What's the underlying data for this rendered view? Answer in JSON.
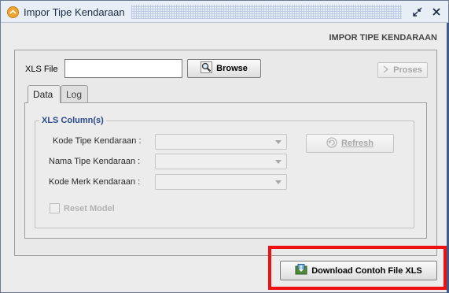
{
  "window": {
    "title": "Impor Tipe Kendaraan",
    "header": "IMPOR TIPE KENDARAAN"
  },
  "file": {
    "label": "XLS File",
    "value": "",
    "browse_label": "Browse",
    "proses_label": "Proses"
  },
  "tabs": [
    {
      "label": "Data",
      "active": true
    },
    {
      "label": "Log",
      "active": false
    }
  ],
  "columns": {
    "legend": "XLS Column(s)",
    "fields": [
      {
        "label": "Kode Tipe Kendaraan :",
        "value": ""
      },
      {
        "label": "Nama Tipe Kendaraan :",
        "value": ""
      },
      {
        "label": "Kode Merk  Kendaraan :",
        "value": ""
      }
    ],
    "refresh_label": "Refresh",
    "reset_model_label": "Reset Model",
    "reset_model_checked": false
  },
  "download": {
    "label": "Download Contoh File XLS"
  },
  "colors": {
    "highlight": "#ee1111",
    "legend": "#2a4a8a"
  },
  "icons": [
    "app-icon",
    "restore-icon",
    "close-icon",
    "magnifier-icon",
    "proses-arrow-icon",
    "refresh-icon",
    "download-icon"
  ]
}
